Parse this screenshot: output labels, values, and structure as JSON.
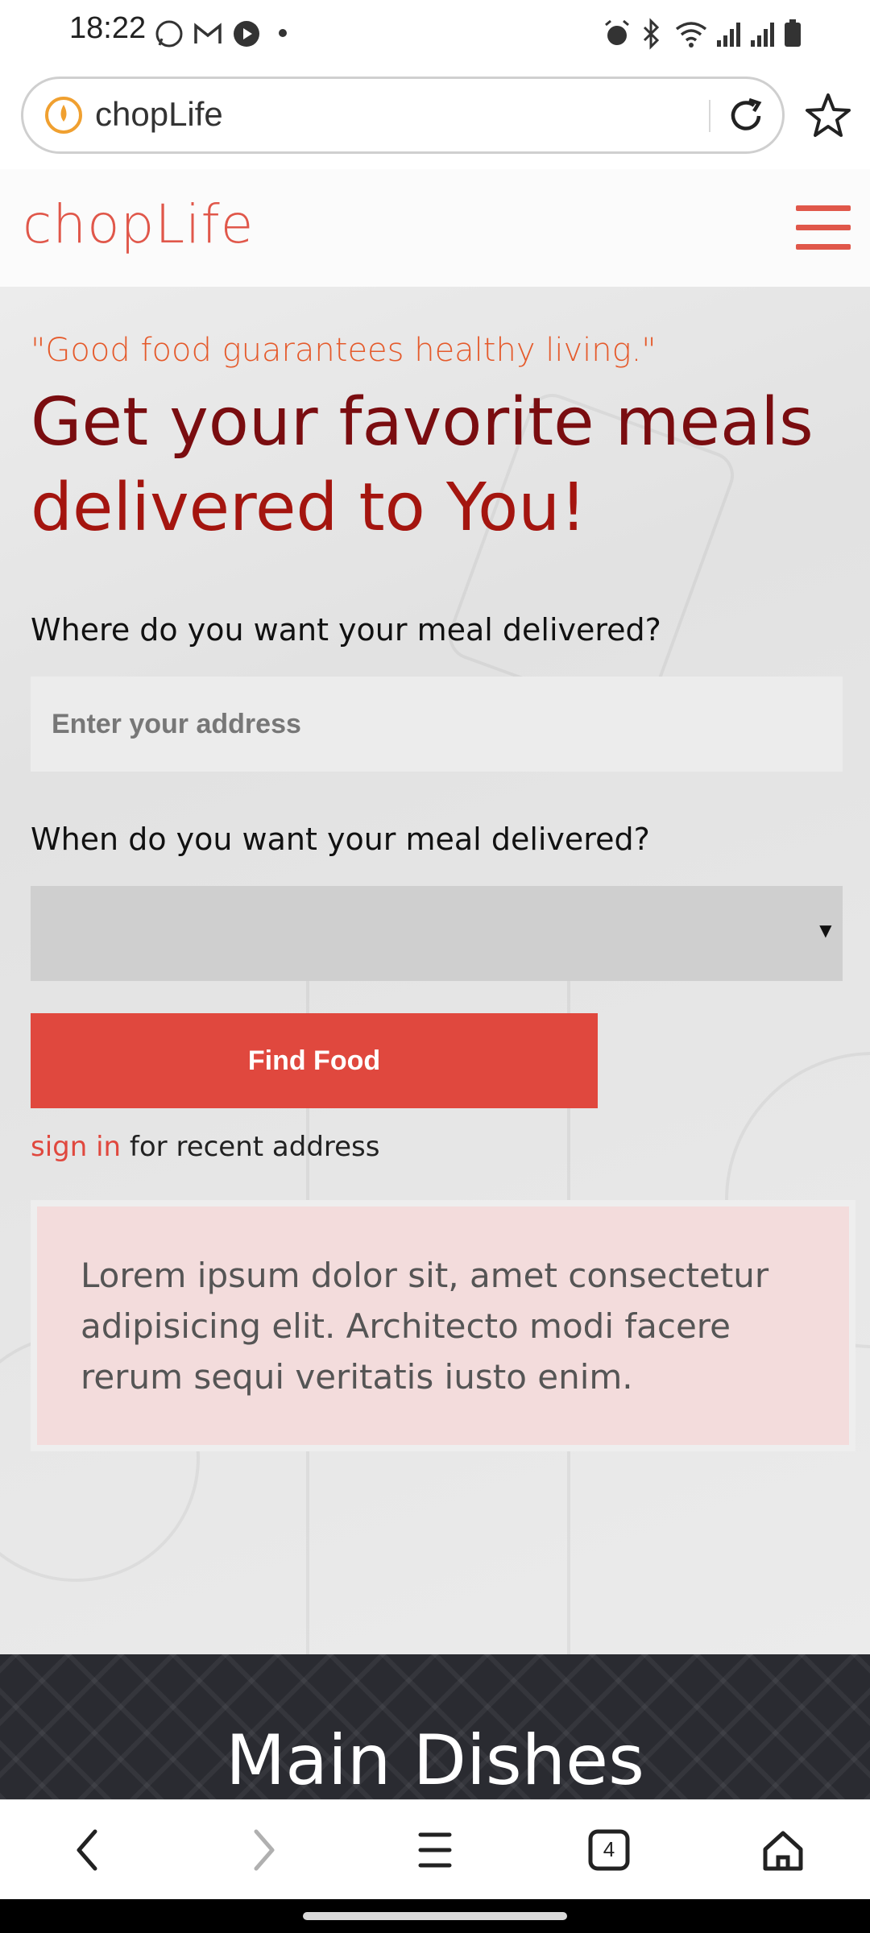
{
  "status_bar": {
    "time": "18:22",
    "left_icons": [
      "whatsapp-icon",
      "gmail-icon",
      "youtube-icon",
      "dot-icon"
    ],
    "right_icons": [
      "alarm-icon",
      "bluetooth-icon",
      "wifi-icon",
      "signal-icon",
      "signal-icon",
      "battery-icon"
    ]
  },
  "browser": {
    "url_text": "chopLife",
    "tab_count": "4"
  },
  "header": {
    "brand": "chopLife"
  },
  "hero": {
    "quote": "\"Good food guarantees healthy living.\"",
    "headline_line1": "Get your favorite meals",
    "headline_line2": "delivered to You!"
  },
  "form": {
    "address_label": "Where do you want your meal delivered?",
    "address_placeholder": "Enter your address",
    "address_value": "",
    "when_label": "When do you want your meal delivered?",
    "when_value": "",
    "find_button": "Find Food",
    "signin_link": "sign in",
    "signin_suffix": " for recent address"
  },
  "info": {
    "text": "Lorem ipsum dolor sit, amet consectetur adipisicing elit. Architecto modi facere rerum sequi veritatis iusto enim."
  },
  "section": {
    "title": "Main Dishes"
  },
  "colors": {
    "accent": "#e0483e",
    "brand": "#e0574a",
    "headline": "#8c0f12",
    "dark_section": "#2a2b31"
  }
}
